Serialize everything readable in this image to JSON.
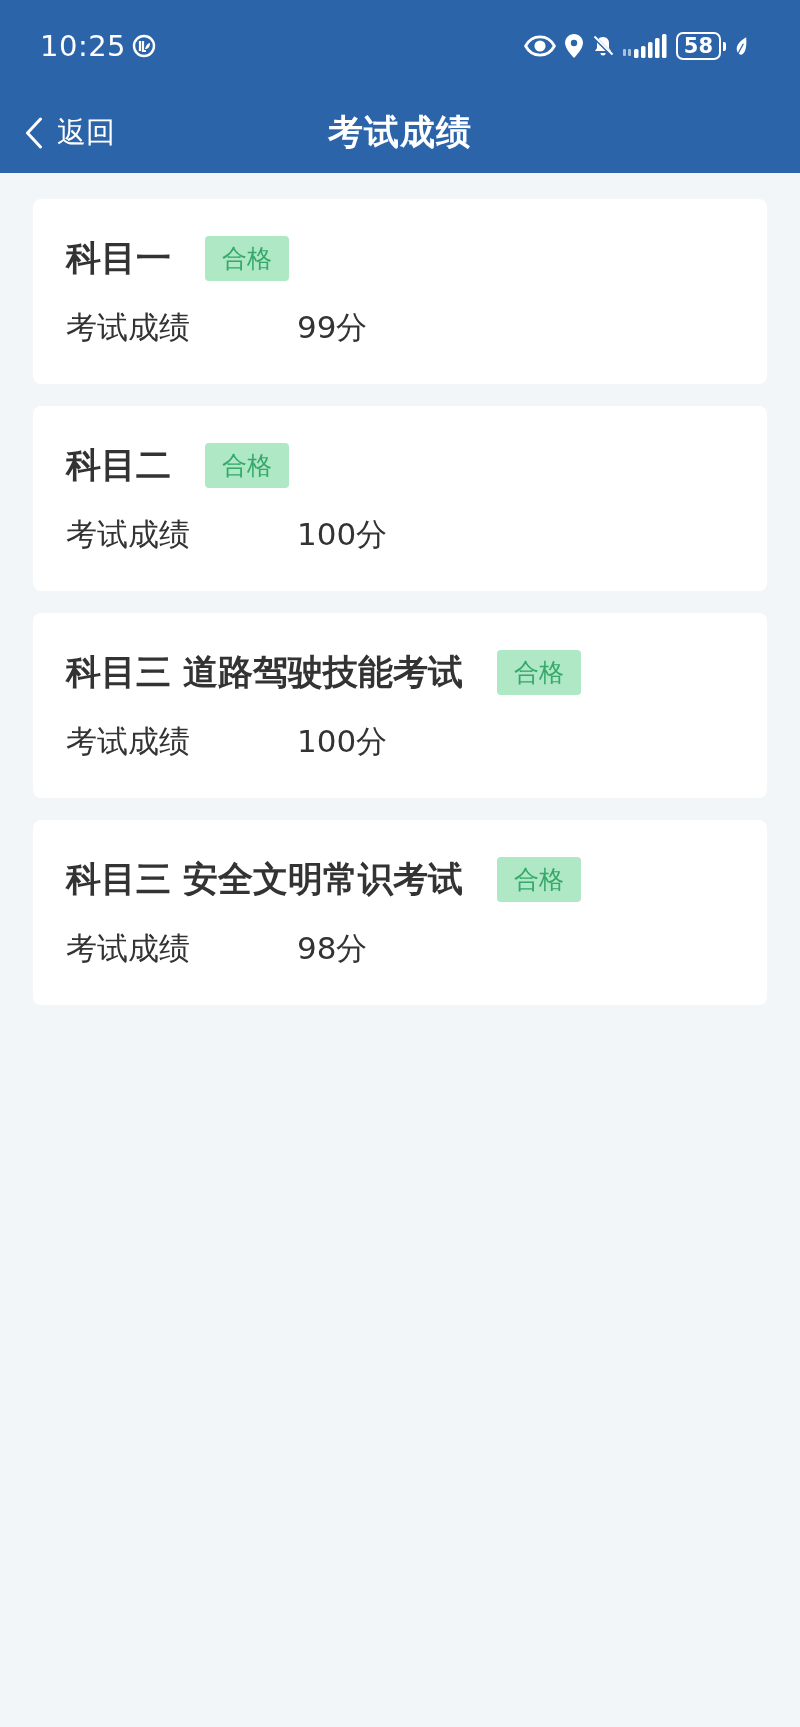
{
  "status_bar": {
    "time": "10:25",
    "battery": "58"
  },
  "nav_bar": {
    "back_label": "返回",
    "title": "考试成绩"
  },
  "results": [
    {
      "subject": "科目一",
      "status": {
        "kind": "pass",
        "label": "合格"
      },
      "score_label": "考试成绩",
      "score": "99分"
    },
    {
      "subject": "科目二",
      "status": {
        "kind": "pass",
        "label": "合格"
      },
      "score_label": "考试成绩",
      "score": "100分"
    },
    {
      "subject": "科目三 道路驾驶技能考试",
      "status": {
        "kind": "pass",
        "label": "合格"
      },
      "score_label": "考试成绩",
      "score": "100分"
    },
    {
      "subject": "科目三 安全文明常识考试",
      "status": {
        "kind": "pass",
        "label": "合格"
      },
      "score_label": "考试成绩",
      "score": "98分"
    }
  ]
}
